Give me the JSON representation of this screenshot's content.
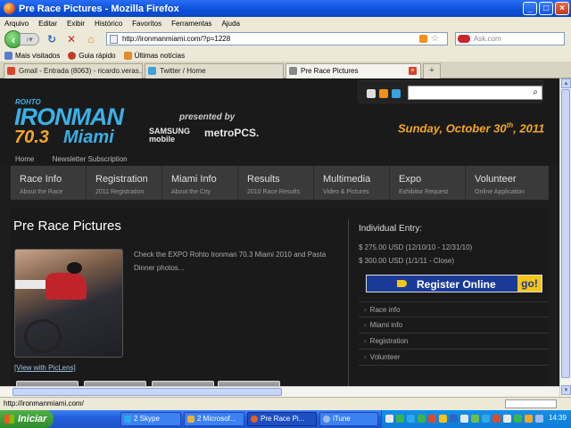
{
  "browser": {
    "title": "Pre Race Pictures - Mozilla Firefox",
    "menu": [
      "Arquivo",
      "Editar",
      "Exibir",
      "Histórico",
      "Favoritos",
      "Ferramentas",
      "Ajuda"
    ],
    "url": "http://ironmanmiami.com/?p=1228",
    "search_placeholder": "Ask.com",
    "bookmarks": [
      "Mais visitados",
      "Guia rápido",
      "Últimas notícias"
    ],
    "tabs": [
      {
        "label": "Gmail - Entrada (8063) - ricardo.veras...",
        "active": false
      },
      {
        "label": "Twitter / Home",
        "active": false
      },
      {
        "label": "Pre Race Pictures",
        "active": true
      }
    ],
    "status": "http://ironmanmiami.com/"
  },
  "site": {
    "logo_rohto": "ROHTO",
    "logo_ironman": "IRONMAN",
    "logo_703": "70.3",
    "logo_miami": "Miami",
    "presented_by": "presented by",
    "sponsor1_line1": "SAMSUNG",
    "sponsor1_line2": "mobile",
    "sponsor2": "metroPCS.",
    "date_text": "Sunday, October 30",
    "date_suffix": "th",
    "date_year": ", 2011",
    "top_links": [
      "Home",
      "Newsletter Subscription"
    ],
    "menu": [
      {
        "title": "Race Info",
        "sub": "About the Race"
      },
      {
        "title": "Registration",
        "sub": "2011 Registration"
      },
      {
        "title": "Miami Info",
        "sub": "About the City"
      },
      {
        "title": "Results",
        "sub": "2010 Race Results"
      },
      {
        "title": "Multimedia",
        "sub": "Video & Pictures"
      },
      {
        "title": "Expo",
        "sub": "Exhibitor Request"
      },
      {
        "title": "Volunteer",
        "sub": "Online Application"
      }
    ],
    "page_title": "Pre Race Pictures",
    "intro": "Check the EXPO Rohto Ironman 70.3 Miami 2010 and Pasta Dinner photos...",
    "view_link": "[View with PicLens]",
    "entry_title": "Individual Entry:",
    "prices": [
      "$ 275.00 USD (12/10/10 - 12/31/10)",
      "$ 300.00 USD (1/1/11 - Close)"
    ],
    "register_label": "Register Online",
    "register_go": "go!",
    "side_links": [
      "Race info",
      "Miami info",
      "Registration",
      "Volunteer"
    ]
  },
  "taskbar": {
    "start": "Iniciar",
    "tasks": [
      {
        "label": "2 Skype",
        "active": false
      },
      {
        "label": "2 Microsof...",
        "active": false
      },
      {
        "label": "Pre Race Pi...",
        "active": true
      },
      {
        "label": "iTune",
        "active": false
      }
    ],
    "clock": "14:39"
  }
}
